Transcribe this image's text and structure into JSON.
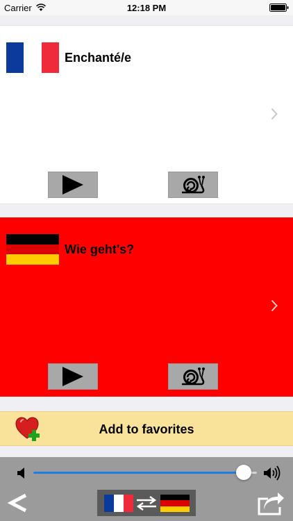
{
  "status_bar": {
    "carrier": "Carrier",
    "time": "12:18 PM"
  },
  "source_card": {
    "flag": "france-flag",
    "flag_colors": [
      "#0a3a9c",
      "#ffffff",
      "#ef2b3b"
    ],
    "phrase": "Enchanté/e",
    "background": "#ffffff"
  },
  "target_card": {
    "flag": "germany-flag",
    "flag_colors": [
      "#000000",
      "#dd0000",
      "#ffcc00"
    ],
    "phrase": "Wie geht's?",
    "background": "#ff0000"
  },
  "favorites": {
    "label": "Add to favorites",
    "background": "#f9e29a"
  },
  "player": {
    "volume_level": 0.94,
    "accent_color": "#1f7be8"
  },
  "icons": {
    "play": "play-icon",
    "slow": "snail-icon",
    "favorite": "heart-plus-icon",
    "back": "back-chevron-icon",
    "swap": "swap-arrows-icon",
    "share": "share-icon"
  }
}
